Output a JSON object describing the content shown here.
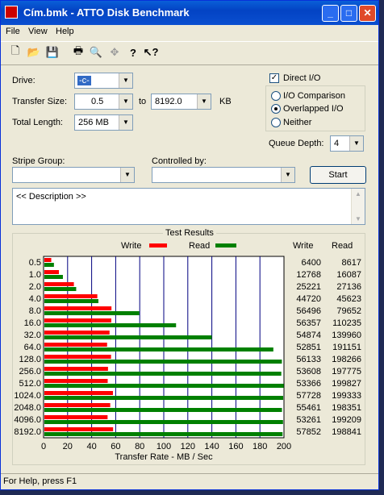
{
  "window": {
    "title": "Cím.bmk - ATTO Disk Benchmark"
  },
  "menu": [
    "File",
    "View",
    "Help"
  ],
  "toolbar": {
    "icons": [
      "new-doc-icon",
      "open-folder-icon",
      "save-icon",
      "print-icon",
      "print-preview-icon",
      "move-icon",
      "help-icon",
      "context-help-icon"
    ]
  },
  "form": {
    "drive_label": "Drive:",
    "drive_value": "-c-",
    "transfer_size_label": "Transfer Size:",
    "transfer_from": "0.5",
    "to_label": "to",
    "transfer_to": "8192.0",
    "kb_label": "KB",
    "total_length_label": "Total Length:",
    "total_length": "256 MB",
    "direct_io_label": "Direct I/O",
    "io_comparison_label": "I/O Comparison",
    "overlapped_io_label": "Overlapped I/O",
    "neither_label": "Neither",
    "queue_depth_label": "Queue Depth:",
    "queue_depth": "4",
    "stripe_group_label": "Stripe Group:",
    "controlled_by_label": "Controlled by:",
    "start_label": "Start",
    "description": "<< Description >>"
  },
  "results": {
    "group_title": "Test Results",
    "write_label": "Write",
    "read_label": "Read",
    "col_write": "Write",
    "col_read": "Read"
  },
  "chart_data": {
    "type": "bar",
    "orientation": "horizontal",
    "categories": [
      "0.5",
      "1.0",
      "2.0",
      "4.0",
      "8.0",
      "16.0",
      "32.0",
      "64.0",
      "128.0",
      "256.0",
      "512.0",
      "1024.0",
      "2048.0",
      "4096.0",
      "8192.0"
    ],
    "series": [
      {
        "name": "Write",
        "color": "#ff0000",
        "values": [
          6400,
          12768,
          25221,
          44720,
          56496,
          56357,
          54874,
          52851,
          56133,
          53608,
          53366,
          57728,
          55461,
          53261,
          57852
        ]
      },
      {
        "name": "Read",
        "color": "#008000",
        "values": [
          8617,
          16087,
          27136,
          45623,
          79652,
          110235,
          139960,
          191151,
          198266,
          197775,
          199827,
          199333,
          198351,
          199209,
          198841
        ]
      }
    ],
    "xlabel": "Transfer Rate - MB / Sec",
    "xticks": [
      "0",
      "20",
      "40",
      "60",
      "80",
      "100",
      "120",
      "140",
      "160",
      "180",
      "200"
    ],
    "xlim": [
      0,
      200
    ],
    "value_unit_note": "values in KB/s; plotted as MB/s",
    "grid": true
  },
  "statusbar": {
    "text": "For Help, press F1"
  }
}
